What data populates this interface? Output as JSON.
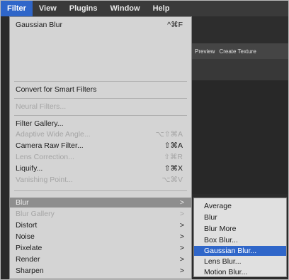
{
  "menubar": [
    "Filter",
    "View",
    "Plugins",
    "Window",
    "Help"
  ],
  "background": {
    "btn1": "Preview",
    "btn2": "Create Texture"
  },
  "menu_items": [
    {
      "label": "Gaussian Blur",
      "shortcut": "^⌘F",
      "enabled": true
    },
    {
      "label": "Convert for Smart Filters",
      "enabled": true
    },
    {
      "label": "Neural Filters...",
      "enabled": false
    },
    {
      "label": "Filter Gallery...",
      "enabled": true
    },
    {
      "label": "Adaptive Wide Angle...",
      "shortcut": "⌥⇧⌘A",
      "enabled": false
    },
    {
      "label": "Camera Raw Filter...",
      "shortcut": "⇧⌘A",
      "enabled": true
    },
    {
      "label": "Lens Correction...",
      "shortcut": "⇧⌘R",
      "enabled": false
    },
    {
      "label": "Liquify...",
      "shortcut": "⇧⌘X",
      "enabled": true
    },
    {
      "label": "Vanishing Point...",
      "shortcut": "⌥⌘V",
      "enabled": false
    },
    {
      "label": "Blur",
      "submenu": true,
      "highlighted": true
    },
    {
      "label": "Blur Gallery",
      "submenu": true,
      "enabled": false
    },
    {
      "label": "Distort",
      "submenu": true
    },
    {
      "label": "Noise",
      "submenu": true
    },
    {
      "label": "Pixelate",
      "submenu": true
    },
    {
      "label": "Render",
      "submenu": true
    },
    {
      "label": "Sharpen",
      "submenu": true
    }
  ],
  "submenu_items": [
    {
      "label": "Average"
    },
    {
      "label": "Blur"
    },
    {
      "label": "Blur More"
    },
    {
      "label": "Box Blur..."
    },
    {
      "label": "Gaussian Blur...",
      "selected": true
    },
    {
      "label": "Lens Blur..."
    },
    {
      "label": "Motion Blur..."
    }
  ],
  "arrow": ">"
}
